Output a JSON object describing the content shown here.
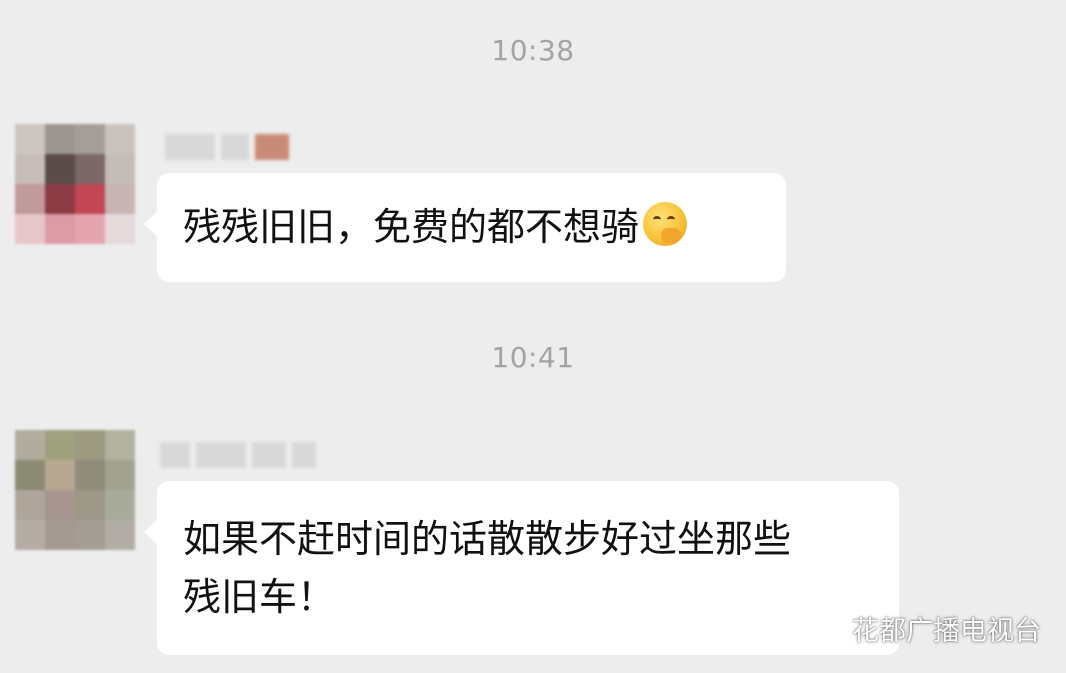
{
  "messages": [
    {
      "time": "10:38",
      "text": "残残旧旧，免费的都不想骑",
      "emoji": "sneaky-smile-emoji",
      "avatar_colors": [
        "#cdc6c0",
        "#9d9591",
        "#a49e99",
        "#c9c3bf",
        "#c7bdb8",
        "#5b4c4b",
        "#7b6867",
        "#c4bcb8",
        "#c19a9b",
        "#8c3b44",
        "#c24653",
        "#c8b4b3",
        "#e6c6cb",
        "#dd9ba6",
        "#e4a4b0",
        "#e4dadc"
      ]
    },
    {
      "time": "10:41",
      "text_line1": "如果不赶时间的话散散步好过坐那些",
      "text_line2": "残旧车！",
      "avatar_colors": [
        "#b1ad9d",
        "#a0a17f",
        "#9c9a7f",
        "#b3b19f",
        "#8b8a72",
        "#b7a991",
        "#8f8c7a",
        "#a3a28e",
        "#aea69a",
        "#a6968f",
        "#9d9887",
        "#a8ab9b",
        "#b4aca4",
        "#a49a91",
        "#a39d94",
        "#b1ada6"
      ]
    }
  ],
  "watermark": {
    "text": "花都广播电视台",
    "icon": "wechat-official-account-icon"
  }
}
